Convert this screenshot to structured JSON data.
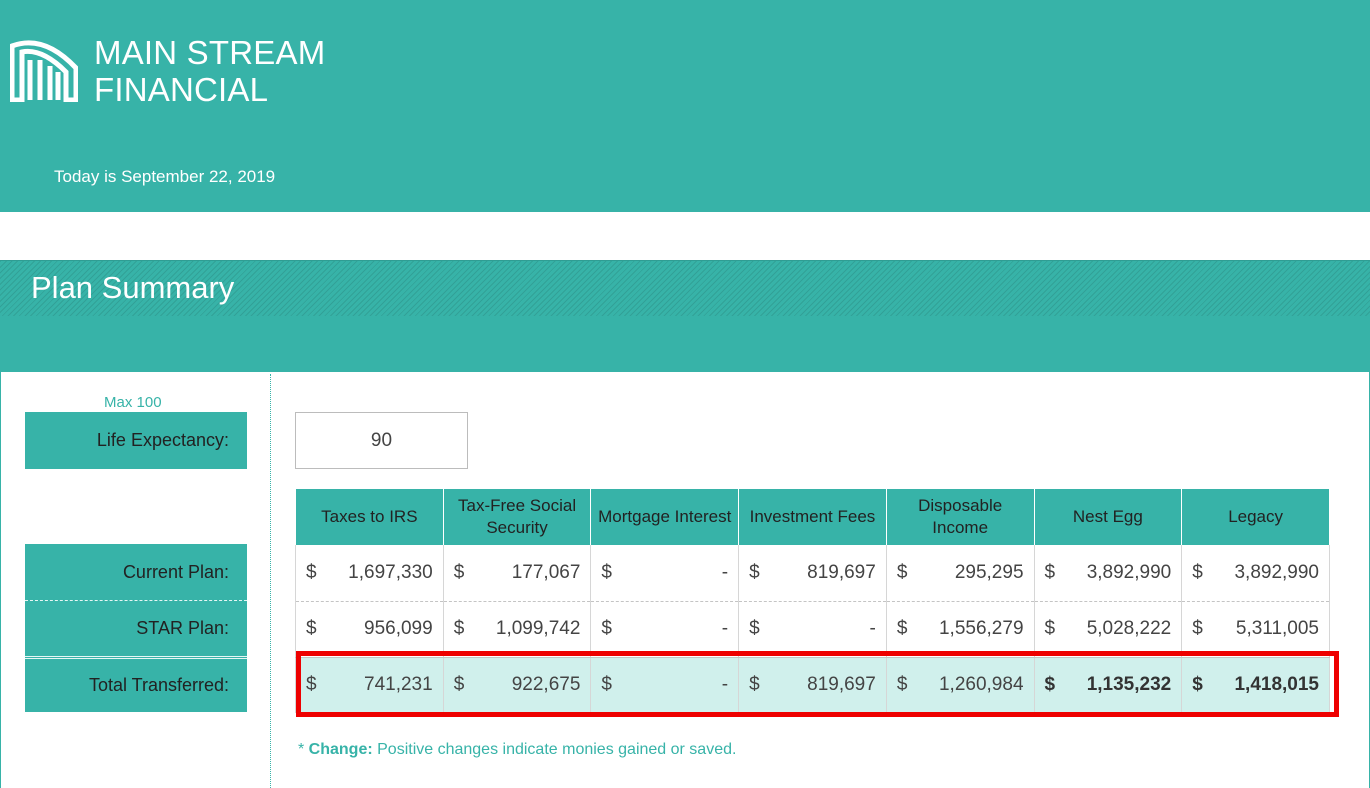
{
  "header": {
    "logo_line1": "MAIN STREAM",
    "logo_line2": "FINANCIAL",
    "today": "Today is September 22, 2019"
  },
  "plan": {
    "title": "Plan Summary"
  },
  "life": {
    "max_label": "Max 100",
    "label": "Life Expectancy:",
    "value": "90"
  },
  "row_labels": {
    "current": "Current Plan:",
    "star": "STAR Plan:",
    "total": "Total Transferred:"
  },
  "table": {
    "currency": "$",
    "headers": [
      "Taxes to IRS",
      "Tax-Free Social Security",
      "Mortgage Interest",
      "Investment Fees",
      "Disposable Income",
      "Nest Egg",
      "Legacy"
    ],
    "rows": {
      "current": [
        "1,697,330",
        "177,067",
        "-",
        "819,697",
        "295,295",
        "3,892,990",
        "3,892,990"
      ],
      "star": [
        "956,099",
        "1,099,742",
        "-",
        "-",
        "1,556,279",
        "5,028,222",
        "5,311,005"
      ],
      "total": [
        "741,231",
        "922,675",
        "-",
        "819,697",
        "1,260,984",
        "1,135,232",
        "1,418,015"
      ]
    }
  },
  "note": {
    "prefix": "* ",
    "bold": "Change:",
    "text": " Positive changes indicate monies gained or saved."
  },
  "colors": {
    "teal": "#37b3a8",
    "highlight": "#ee0000",
    "total_row_bg": "#d0f0ec"
  }
}
